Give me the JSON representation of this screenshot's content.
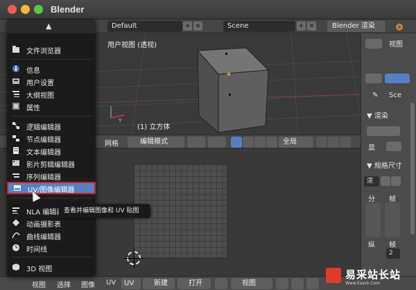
{
  "window": {
    "title": "Blender"
  },
  "infobar": {
    "screen_layout": "Default",
    "scene": "Scene",
    "render_engine": "Blender 渲染"
  },
  "viewport": {
    "label": "用户视图 (透视)",
    "object_label": "(1) 立方体"
  },
  "viewport_header": {
    "grid_label": "网格",
    "mode": "编辑模式",
    "pivot": "全局"
  },
  "bottom_header": {
    "view": "视图",
    "select": "选择",
    "image": "图像",
    "uv": "UV",
    "uv2": "UV",
    "new_button": "新建",
    "open_button": "打开",
    "view_combo": "视图"
  },
  "right_panel": {
    "view_tab": "视图",
    "scene_tab": "Sce",
    "render_section": "▼ 渲染",
    "display_label": "显",
    "dimensions_section": "▼ 规格尺寸",
    "render_preset": "渲",
    "fen": "分",
    "zhen": "帧",
    "zong": "纵",
    "zhen2": "帧",
    "frame_value": "2"
  },
  "menu": {
    "items": [
      {
        "label": "文件浏览器",
        "icon": "folder-icon"
      },
      {
        "label": "信息",
        "icon": "info-icon"
      },
      {
        "label": "用户设置",
        "icon": "user-prefs-icon"
      },
      {
        "label": "大纲视图",
        "icon": "outliner-icon"
      },
      {
        "label": "属性",
        "icon": "properties-icon"
      },
      {
        "label": "逻辑编辑器",
        "icon": "logic-icon"
      },
      {
        "label": "节点编辑器",
        "icon": "node-icon"
      },
      {
        "label": "文本编辑器",
        "icon": "text-icon"
      },
      {
        "label": "影片剪辑编辑器",
        "icon": "clip-icon"
      },
      {
        "label": "序列编辑器",
        "icon": "sequence-icon"
      },
      {
        "label": "UV/图像编辑器",
        "icon": "image-icon"
      },
      {
        "label": "NLA 编辑器",
        "icon": "nla-icon"
      },
      {
        "label": "动画摄影表",
        "icon": "dopesheet-icon"
      },
      {
        "label": "曲线编辑器",
        "icon": "graph-icon"
      },
      {
        "label": "时间线",
        "icon": "timeline-icon"
      },
      {
        "label": "3D 视图",
        "icon": "view3d-icon"
      }
    ]
  },
  "tooltip": "查看并编辑图像和 UV 贴图",
  "watermark": {
    "text": "易采站长站",
    "sub": "Www.Easck.Com"
  },
  "colors": {
    "accent": "#5680c2",
    "highlight_border": "#d02020",
    "menu_bg": "#1b1b1b"
  }
}
